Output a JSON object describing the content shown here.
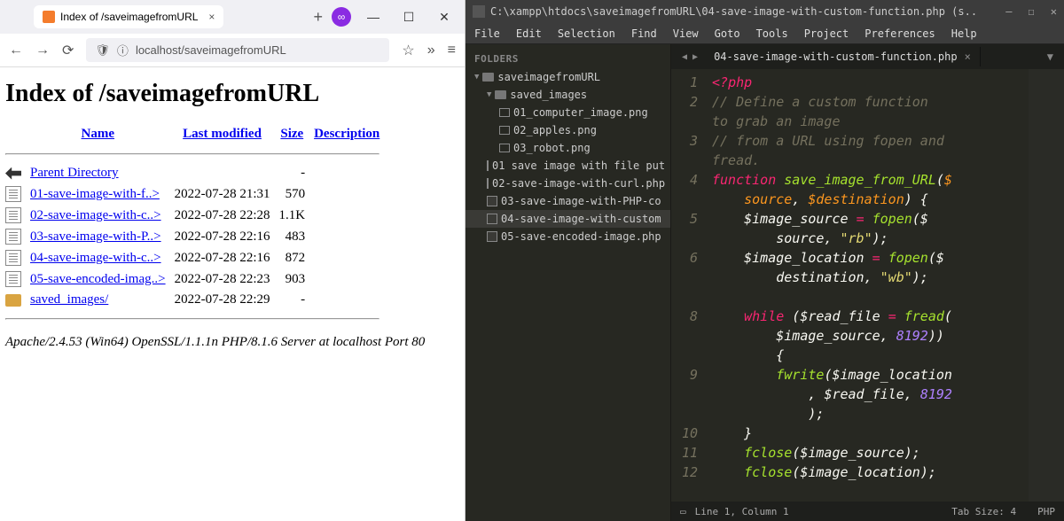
{
  "browser": {
    "tab_title": "Index of /saveimagefromURL",
    "url_display": "localhost/saveimagefromURL",
    "page_title": "Index of /saveimagefromURL",
    "headers": {
      "name": "Name",
      "modified": "Last modified",
      "size": "Size",
      "desc": "Description"
    },
    "parent_dir": "Parent Directory",
    "rows": [
      {
        "name": "01-save-image-with-f..>",
        "date": "2022-07-28 21:31",
        "size": "570",
        "type": "file"
      },
      {
        "name": "02-save-image-with-c..>",
        "date": "2022-07-28 22:28",
        "size": "1.1K",
        "type": "file"
      },
      {
        "name": "03-save-image-with-P..>",
        "date": "2022-07-28 22:16",
        "size": "483",
        "type": "file"
      },
      {
        "name": "04-save-image-with-c..>",
        "date": "2022-07-28 22:16",
        "size": "872",
        "type": "file"
      },
      {
        "name": "05-save-encoded-imag..>",
        "date": "2022-07-28 22:23",
        "size": "903",
        "type": "file"
      },
      {
        "name": "saved_images/",
        "date": "2022-07-28 22:29",
        "size": "-",
        "type": "dir"
      }
    ],
    "server_sig": "Apache/2.4.53 (Win64) OpenSSL/1.1.1n PHP/8.1.6 Server at localhost Port 80"
  },
  "editor": {
    "title_path": "C:\\xampp\\htdocs\\saveimagefromURL\\04-save-image-with-custom-function.php (s..",
    "menu": [
      "File",
      "Edit",
      "Selection",
      "Find",
      "View",
      "Goto",
      "Tools",
      "Project",
      "Preferences",
      "Help"
    ],
    "sidebar_header": "FOLDERS",
    "tree": {
      "root": "saveimagefromURL",
      "folder": "saved_images",
      "images": [
        "01_computer_image.png",
        "02_apples.png",
        "03_robot.png"
      ],
      "files": [
        "01 save image with file put",
        "02-save-image-with-curl.php",
        "03-save-image-with-PHP-co",
        "04-save-image-with-custom",
        "05-save-encoded-image.php"
      ]
    },
    "tab_name": "04-save-image-with-custom-function.php",
    "line_numbers": [
      "1",
      "2",
      "",
      "3",
      "",
      "4",
      "",
      "5",
      "",
      "6",
      "",
      "",
      "8",
      "",
      "",
      "9",
      "",
      "",
      "10",
      "11",
      "12"
    ],
    "code_lines": [
      {
        "t": "php_open",
        "txt": "<?php"
      },
      {
        "t": "comment",
        "txt": "// Define a custom function to grab an image"
      },
      {
        "t": "comment",
        "txt": "// from a URL using fopen and fread."
      },
      {
        "t": "func_sig",
        "parts": [
          "function",
          " ",
          "save_image_from_URL",
          "(",
          "$source",
          ", ",
          "$destination",
          ") {"
        ]
      },
      {
        "t": "assign",
        "parts": [
          "    ",
          "$image_source",
          " = ",
          "fopen",
          "(",
          "$source",
          ", ",
          "\"rb\"",
          ");"
        ]
      },
      {
        "t": "assign",
        "parts": [
          "    ",
          "$image_location",
          " = ",
          "fopen",
          "(",
          "$destination",
          ", ",
          "\"wb\"",
          ");"
        ]
      },
      {
        "t": "blank",
        "txt": ""
      },
      {
        "t": "while",
        "parts": [
          "    ",
          "while",
          " (",
          "$read_file",
          " = ",
          "fread",
          "(",
          "$image_source",
          ", ",
          "8192",
          ")) {"
        ]
      },
      {
        "t": "call",
        "parts": [
          "        ",
          "fwrite",
          "(",
          "$image_location",
          ", ",
          "$read_file",
          ", ",
          "8192",
          ");"
        ]
      },
      {
        "t": "brace",
        "txt": "    }"
      },
      {
        "t": "call2",
        "parts": [
          "    ",
          "fclose",
          "(",
          "$image_source",
          ");"
        ]
      },
      {
        "t": "call2",
        "parts": [
          "    ",
          "fclose",
          "(",
          "$image_location",
          ");"
        ]
      }
    ],
    "status_left": "Line 1, Column 1",
    "status_tab": "Tab Size: 4",
    "status_lang": "PHP"
  }
}
